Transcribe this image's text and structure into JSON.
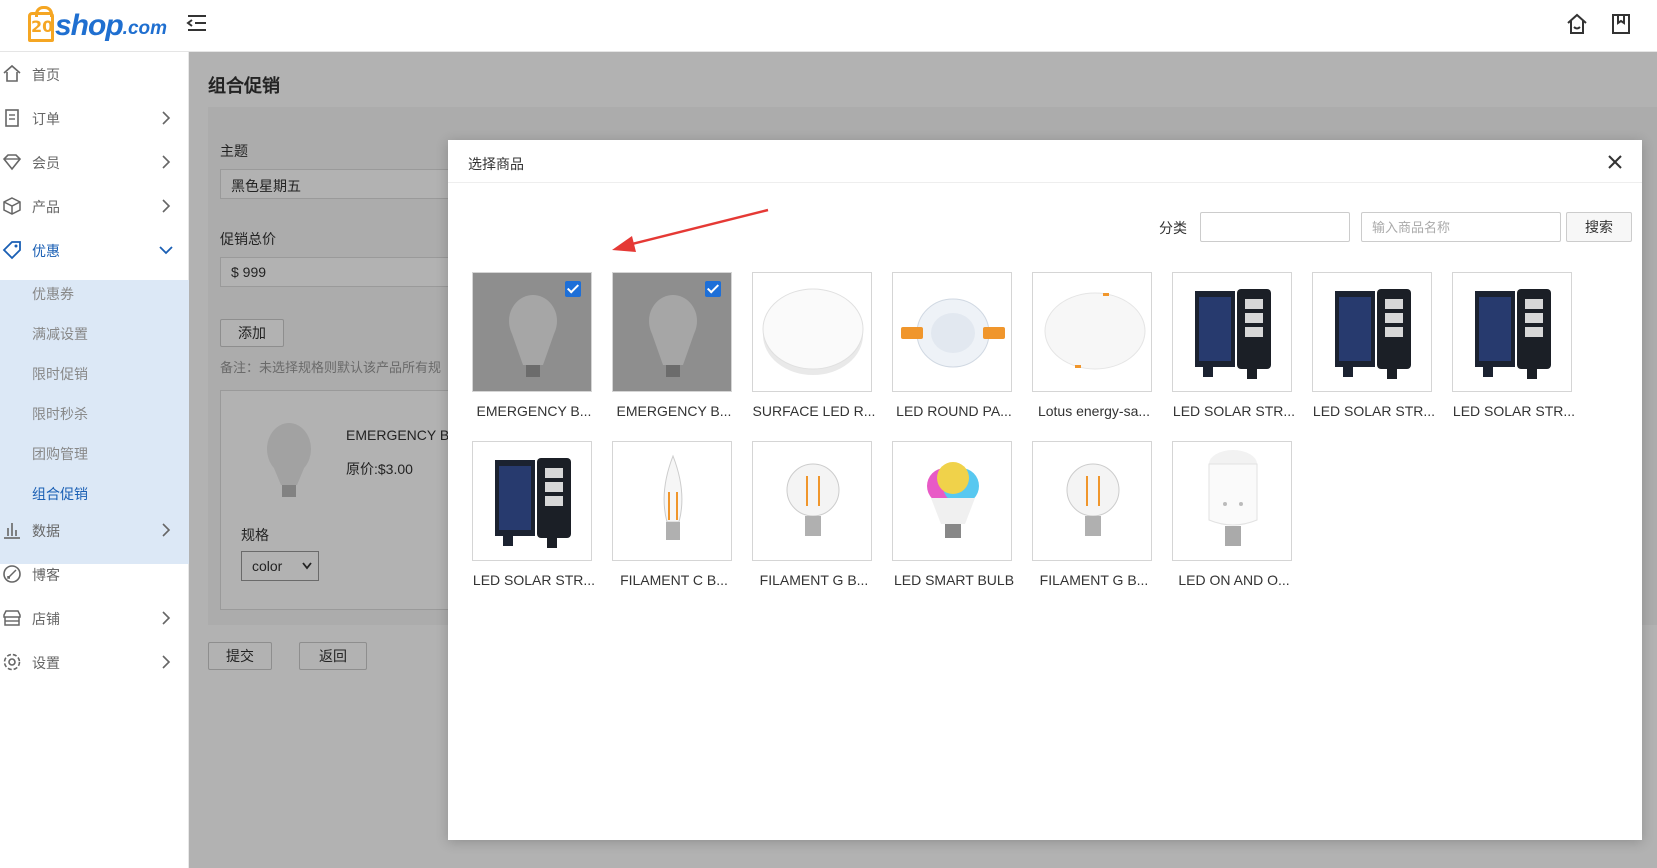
{
  "header": {
    "logo_badge": "20",
    "logo_text": "shop",
    "logo_domain": ".com"
  },
  "sidebar": {
    "items": [
      {
        "label": "首页",
        "icon": "home-icon"
      },
      {
        "label": "订单",
        "icon": "order-icon"
      },
      {
        "label": "会员",
        "icon": "member-icon"
      },
      {
        "label": "产品",
        "icon": "product-icon"
      },
      {
        "label": "优惠",
        "icon": "tag-icon"
      },
      {
        "label": "数据",
        "icon": "chart-icon"
      },
      {
        "label": "博客",
        "icon": "blog-icon"
      },
      {
        "label": "店铺",
        "icon": "store-icon"
      },
      {
        "label": "设置",
        "icon": "gear-icon"
      }
    ],
    "sub_items": [
      "优惠券",
      "满减设置",
      "限时促销",
      "限时秒杀",
      "团购管理",
      "组合促销"
    ]
  },
  "page": {
    "title": "组合促销",
    "topic_label": "主题",
    "topic_value": "黑色星期五",
    "price_label": "促销总价",
    "price_value": "$ 999",
    "add_button": "添加",
    "note": "备注：未选择规格则默认该产品所有规",
    "product_name": "EMERGENCY B",
    "product_price": "原价:$3.00",
    "spec_label": "规格",
    "spec_value": "color",
    "submit_button": "提交",
    "back_button": "返回"
  },
  "modal": {
    "title": "选择商品",
    "category_label": "分类",
    "search_placeholder": "输入商品名称",
    "search_button": "搜索",
    "products": [
      {
        "name": "EMERGENCY B...",
        "selected": true,
        "kind": "bulb-a"
      },
      {
        "name": "EMERGENCY B...",
        "selected": true,
        "kind": "bulb-a"
      },
      {
        "name": "SURFACE LED R...",
        "selected": false,
        "kind": "round-panel"
      },
      {
        "name": "LED ROUND PA...",
        "selected": false,
        "kind": "downlight"
      },
      {
        "name": "Lotus energy-sa...",
        "selected": false,
        "kind": "flat-panel"
      },
      {
        "name": "LED SOLAR STR...",
        "selected": false,
        "kind": "solar"
      },
      {
        "name": "LED SOLAR STR...",
        "selected": false,
        "kind": "solar"
      },
      {
        "name": "LED SOLAR STR...",
        "selected": false,
        "kind": "solar"
      },
      {
        "name": "LED SOLAR STR...",
        "selected": false,
        "kind": "solar"
      },
      {
        "name": "FILAMENT C B...",
        "selected": false,
        "kind": "candle"
      },
      {
        "name": "FILAMENT G B...",
        "selected": false,
        "kind": "globe"
      },
      {
        "name": "LED SMART BULB",
        "selected": false,
        "kind": "rgb"
      },
      {
        "name": "FILAMENT G B...",
        "selected": false,
        "kind": "globe"
      },
      {
        "name": "LED ON AND O...",
        "selected": false,
        "kind": "tall-bulb"
      }
    ]
  },
  "colors": {
    "accent": "#1a5fb4",
    "checkbox": "#1d6fd8",
    "arrow": "#e53935",
    "logo_orange": "#f5a623"
  }
}
